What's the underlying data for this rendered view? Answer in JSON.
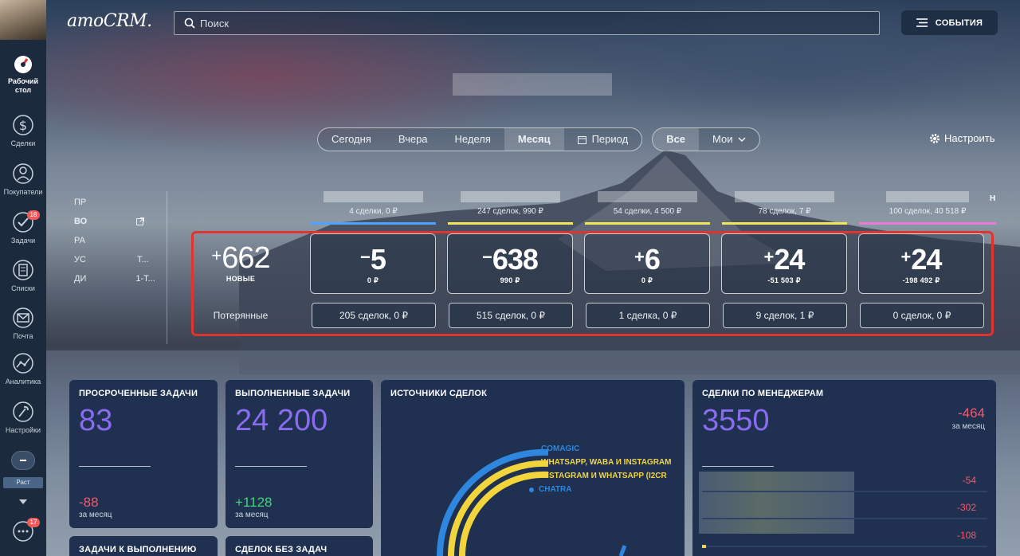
{
  "app": {
    "logo": "amoCRM."
  },
  "search": {
    "placeholder": "Поиск"
  },
  "events_button": {
    "label": "СОБЫТИЯ"
  },
  "sidebar": {
    "items": [
      {
        "label": "Рабочий стол",
        "icon": "dashboard-icon",
        "active": true
      },
      {
        "label": "Сделки",
        "icon": "dollar-icon"
      },
      {
        "label": "Покупатели",
        "icon": "customers-icon"
      },
      {
        "label": "Задачи",
        "icon": "tasks-icon",
        "badge": "18"
      },
      {
        "label": "Списки",
        "icon": "lists-icon"
      },
      {
        "label": "Почта",
        "icon": "mail-icon"
      },
      {
        "label": "Аналитика",
        "icon": "analytics-icon"
      },
      {
        "label": "Настройки",
        "icon": "settings-icon"
      }
    ],
    "rest_label": "Раст",
    "chat_badge": "17"
  },
  "filters": {
    "period": [
      "Сегодня",
      "Вчера",
      "Неделя",
      "Месяц",
      "Период"
    ],
    "period_active": "Месяц",
    "scope": [
      "Все",
      "Мои"
    ],
    "scope_active": "Все"
  },
  "settings_label": "Настроить",
  "left_labels": [
    "ПР",
    "ВО",
    "РА",
    "УС",
    "ДИ"
  ],
  "left_labels_suffix": {
    "row4": "Т...",
    "row5": "1-Т..."
  },
  "stages": [
    {
      "summary": "4 сделки, 0 ₽",
      "color": "#4aa3ff"
    },
    {
      "summary": "247 сделок, 990 ₽",
      "color": "#f2e65a"
    },
    {
      "summary": "54 сделки, 4 500 ₽",
      "color": "#f2e65a"
    },
    {
      "summary": "78 сделок, 7 ₽",
      "color": "#f2e65a"
    },
    {
      "summary": "100 сделок, 40 518 ₽",
      "color": "#e87bd8"
    }
  ],
  "stage_extra_letter": "Н",
  "new_block": {
    "sign": "+",
    "value": "662",
    "label": "НОВЫЕ"
  },
  "lost_label": "Потерянные",
  "stage_cards": [
    {
      "sign": "−",
      "value": "5",
      "amount": "0 ₽",
      "lost": "205 сделок, 0 ₽"
    },
    {
      "sign": "−",
      "value": "638",
      "amount": "990 ₽",
      "lost": "515 сделок, 0 ₽"
    },
    {
      "sign": "+",
      "value": "6",
      "amount": "0 ₽",
      "lost": "1 сделка, 0 ₽"
    },
    {
      "sign": "+",
      "value": "24",
      "amount": "-51 503 ₽",
      "lost": "9 сделок, 1 ₽"
    },
    {
      "sign": "+",
      "value": "24",
      "amount": "-198 492 ₽",
      "lost": "0 сделок, 0 ₽"
    }
  ],
  "widgets": {
    "overdue": {
      "title": "ПРОСРОЧЕННЫЕ ЗАДАЧИ",
      "value": "83",
      "delta": "-88",
      "delta_sub": "за месяц"
    },
    "done": {
      "title": "ВЫПОЛНЕННЫЕ ЗАДАЧИ",
      "value": "24 200",
      "delta": "+1128",
      "delta_sub": "за месяц"
    },
    "sources": {
      "title": "ИСТОЧНИКИ СДЕЛОК",
      "legend": [
        {
          "name": "COMAGIC",
          "color": "#2e86de"
        },
        {
          "name": "WHATSAPP, WABA И INSTAGRAM",
          "color": "#f2d43c"
        },
        {
          "name": "INSTAGRAM И WHATSAPP (I2CR",
          "color": "#f2d43c"
        },
        {
          "name": "CHATRA",
          "color": "#2e86de"
        }
      ]
    },
    "managers": {
      "title": "СДЕЛКИ ПО МЕНЕДЖЕРАМ",
      "value": "3550",
      "delta": "-464",
      "delta_sub": "за месяц",
      "rows": [
        "-54",
        "-302",
        "-108"
      ]
    },
    "todo": {
      "title": "ЗАДАЧИ К ВЫПОЛНЕНИЮ"
    },
    "no_tasks": {
      "title": "СДЕЛОК БЕЗ ЗАДАЧ"
    }
  }
}
